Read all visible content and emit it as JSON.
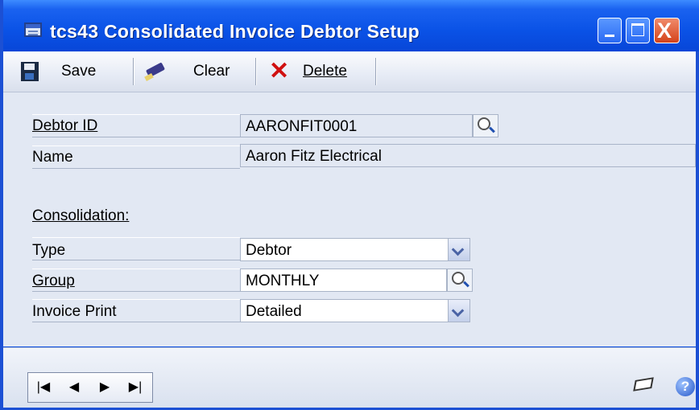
{
  "window": {
    "title": "tcs43 Consolidated Invoice Debtor Setup",
    "close_glyph": "X"
  },
  "toolbar": {
    "save_label": "Save",
    "clear_label": "Clear",
    "delete_label": "Delete"
  },
  "form": {
    "debtor_id_label": "Debtor ID",
    "debtor_id_value": "AARONFIT0001",
    "name_label": "Name",
    "name_value": "Aaron Fitz Electrical",
    "consolidation_label": "Consolidation:",
    "type_label": "Type",
    "type_value": "Debtor",
    "group_label": "Group",
    "group_value": "MONTHLY",
    "invoice_print_label": "Invoice Print",
    "invoice_print_value": "Detailed"
  },
  "navigation": {
    "first": "|◀",
    "prev": "◀",
    "next": "▶",
    "last": "▶|"
  },
  "help_glyph": "?",
  "colors": {
    "titlebar": "#0a52e6",
    "content_bg": "#e2e8f3",
    "delete_red": "#d01010"
  }
}
